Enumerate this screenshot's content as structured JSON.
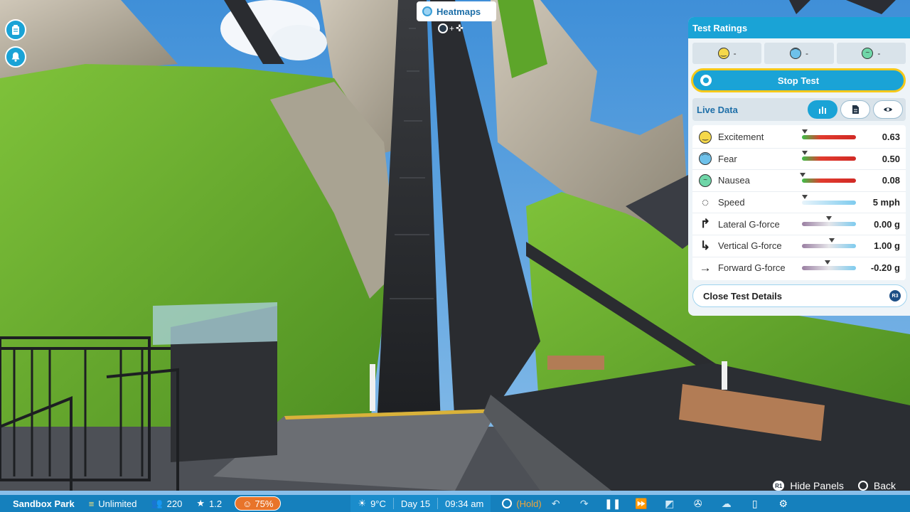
{
  "scene": {
    "description_icon": "roller-coaster-scene"
  },
  "hud": {
    "left_buttons": [
      {
        "icon": "clipboard-icon"
      },
      {
        "icon": "bell-icon"
      }
    ]
  },
  "heatmaps": {
    "label": "Heatmaps",
    "key_hint": "+"
  },
  "panel": {
    "title": "Test Ratings",
    "ratings": [
      {
        "icon": "excitement-face-icon",
        "value": "-"
      },
      {
        "icon": "fear-face-icon",
        "value": "-"
      },
      {
        "icon": "nausea-face-icon",
        "value": "-"
      }
    ],
    "stop_test_label": "Stop Test",
    "live_data_label": "Live Data",
    "live_tabs": [
      {
        "icon": "bar-chart-icon",
        "active": true
      },
      {
        "icon": "document-icon",
        "active": false
      },
      {
        "icon": "eye-icon",
        "active": false
      }
    ],
    "stats": [
      {
        "name": "Excitement",
        "value": "0.63",
        "marker": 0.05,
        "kind": "rating",
        "icon": "excitement-face-icon"
      },
      {
        "name": "Fear",
        "value": "0.50",
        "marker": 0.05,
        "kind": "rating",
        "icon": "fear-face-icon"
      },
      {
        "name": "Nausea",
        "value": "0.08",
        "marker": 0.01,
        "kind": "rating",
        "icon": "nausea-face-icon"
      },
      {
        "name": "Speed",
        "value": "5 mph",
        "marker": 0.05,
        "kind": "speed",
        "icon": "speed-icon"
      },
      {
        "name": "Lateral G-force",
        "value": "0.00 g",
        "marker": 0.5,
        "kind": "g",
        "icon": "lateral-arrow-icon"
      },
      {
        "name": "Vertical G-force",
        "value": "1.00 g",
        "marker": 0.55,
        "kind": "g",
        "icon": "vertical-arrow-icon"
      },
      {
        "name": "Forward G-force",
        "value": "-0.20 g",
        "marker": 0.48,
        "kind": "g",
        "icon": "forward-arrow-icon"
      }
    ],
    "close_label": "Close Test Details",
    "close_key": "R3"
  },
  "hints": {
    "hide_key": "R1",
    "hide_label": "Hide Panels",
    "back_label": "Back"
  },
  "bottom_bar": {
    "park_name": "Sandbox Park",
    "money": "Unlimited",
    "guests": "220",
    "park_rating": "1.2",
    "approval": "75%",
    "temperature": "9°C",
    "day": "Day 15",
    "time": "09:34 am",
    "hold_label": "(Hold)"
  },
  "colors": {
    "accent": "#1aa3d6",
    "bar": "#1580bd",
    "highlight": "#f6c91a",
    "approval": "#e8742a"
  }
}
